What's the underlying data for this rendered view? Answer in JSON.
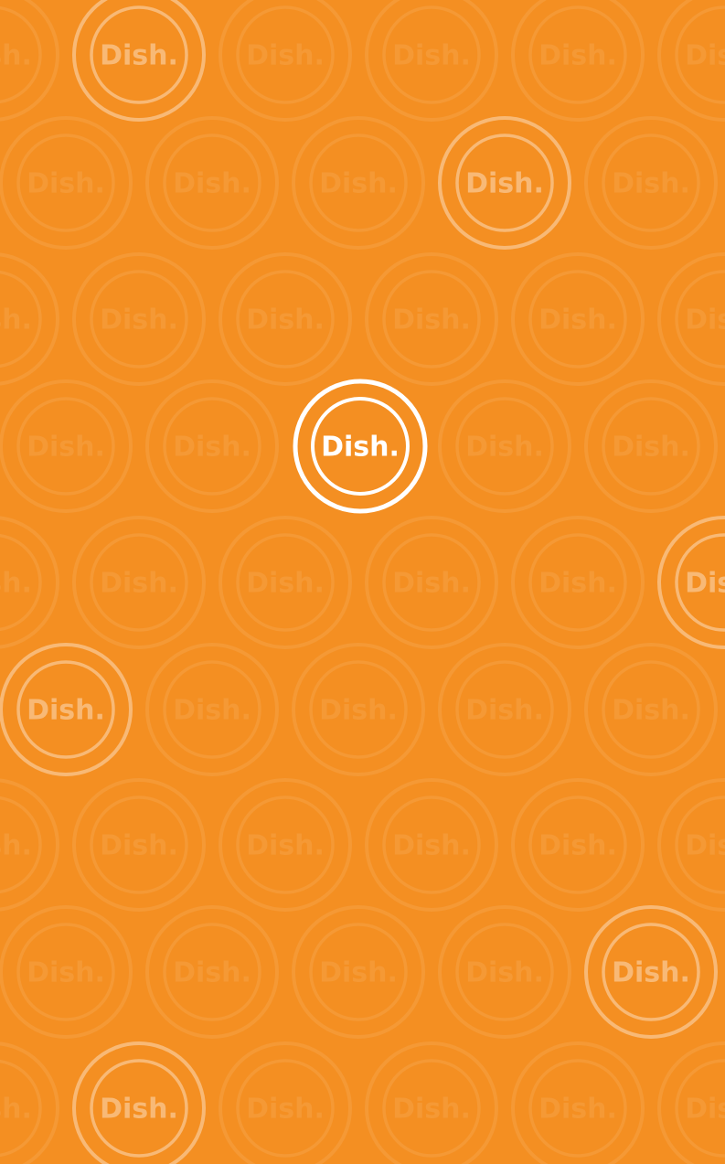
{
  "app": {
    "brand_text": "Dish."
  },
  "colors": {
    "background": "#f48f22",
    "logo": "#ffffff",
    "pattern_faint": "rgba(255,255,255,0.09)",
    "pattern_highlight": "rgba(255,255,255,0.38)"
  }
}
